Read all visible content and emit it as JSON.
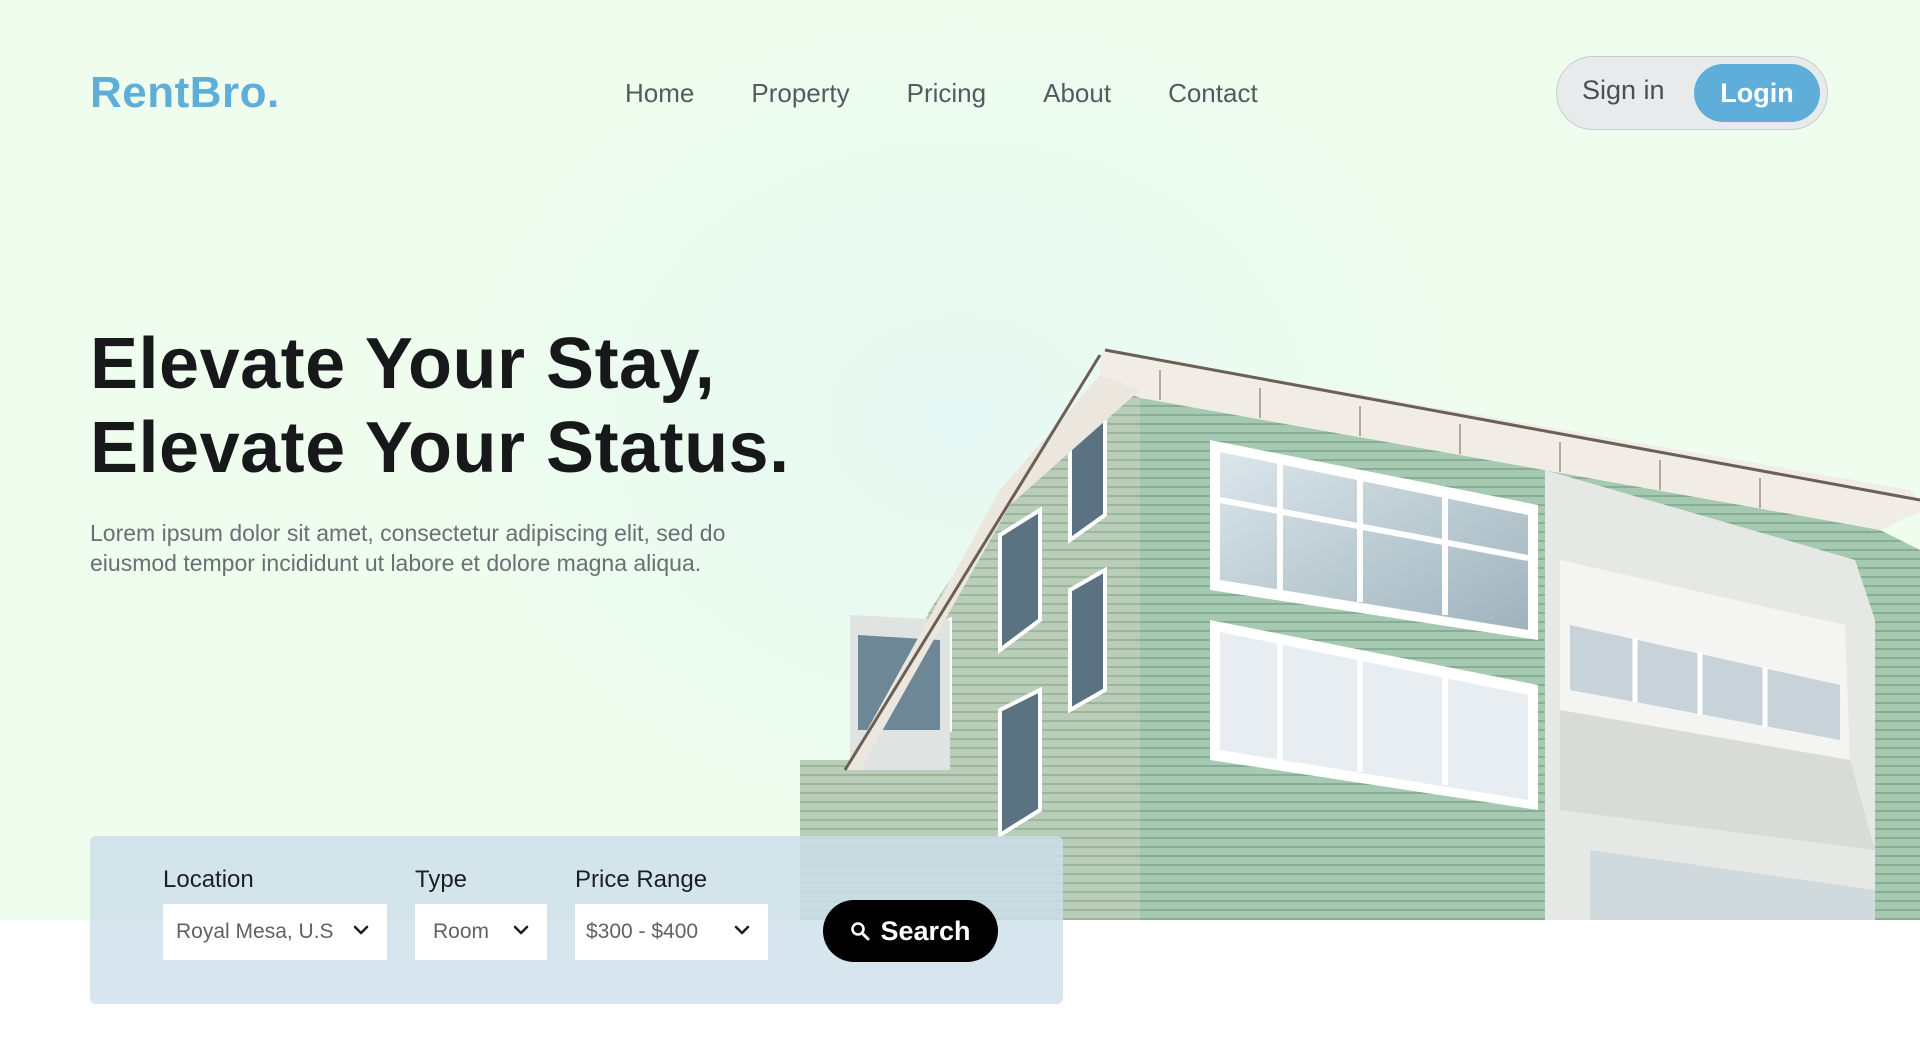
{
  "brand": {
    "logo_text": "RentBro."
  },
  "nav": {
    "items": [
      {
        "label": "Home"
      },
      {
        "label": "Property"
      },
      {
        "label": "Pricing"
      },
      {
        "label": "About"
      },
      {
        "label": "Contact"
      }
    ]
  },
  "auth": {
    "signin_label": "Sign in",
    "login_label": "Login"
  },
  "hero": {
    "headline_line1": "Elevate Your Stay,",
    "headline_line2": "Elevate Your Status.",
    "subtext": "Lorem ipsum dolor sit amet, consectetur adipiscing elit, sed do eiusmod tempor incididunt ut labore et dolore magna aliqua."
  },
  "search": {
    "location": {
      "label": "Location",
      "value": "Royal Mesa, U.S"
    },
    "type": {
      "label": "Type",
      "value": "Room"
    },
    "price": {
      "label": "Price Range",
      "value": "$300 - $400"
    },
    "button_label": "Search"
  },
  "icons": {
    "search": "search-icon",
    "chevron": "chevron-down-icon",
    "building": "apartment-building-image"
  },
  "colors": {
    "brand": "#5faed9",
    "hero_bg": "#eefdee",
    "search_panel": "#cddfea",
    "button_dark": "#000000",
    "building_siding": "#9fc4ad"
  }
}
